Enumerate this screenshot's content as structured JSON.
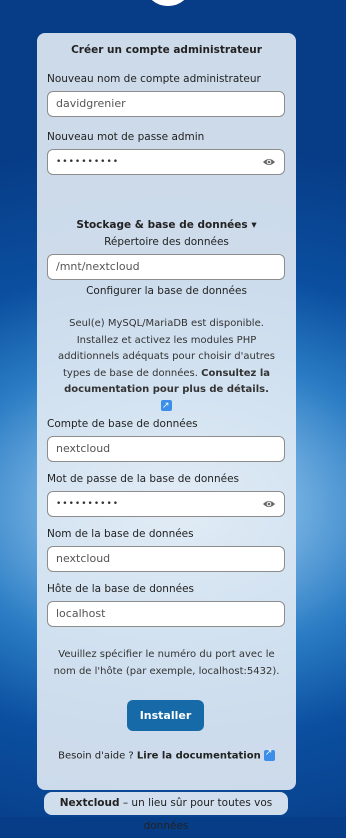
{
  "form": {
    "title": "Créer un compte administrateur",
    "admin_user_label": "Nouveau nom de compte administrateur",
    "admin_user_value": "davidgrenier",
    "admin_pass_label": "Nouveau mot de passe admin",
    "admin_pass_value": "••••••••••",
    "storage_toggle": "Stockage & base de données ▾",
    "data_dir_label": "Répertoire des données",
    "data_dir_value": "/mnt/nextcloud",
    "configure_db": "Configurer la base de données",
    "info_text": "Seul(e) MySQL/MariaDB est disponible. Installez et activez les modules PHP additionnels adéquats pour choisir d'autres types de base de données.",
    "info_link": "Consultez la documentation pour plus de détails.",
    "db_user_label": "Compte de base de données",
    "db_user_value": "nextcloud",
    "db_pass_label": "Mot de passe de la base de données",
    "db_pass_value": "••••••••••",
    "db_name_label": "Nom de la base de données",
    "db_name_value": "nextcloud",
    "db_host_label": "Hôte de la base de données",
    "db_host_value": "localhost",
    "port_hint": "Veuillez spécifier le numéro du port avec le nom de l'hôte (par exemple, localhost:5432).",
    "install_button": "Installer",
    "help_prefix": "Besoin d'aide ?",
    "help_link": "Lire la documentation"
  },
  "footer": {
    "brand": "Nextcloud",
    "tagline": "– un lieu sûr pour toutes vos données"
  },
  "colors": {
    "accent": "#176aa8",
    "link_icon": "#3b8fe8"
  }
}
